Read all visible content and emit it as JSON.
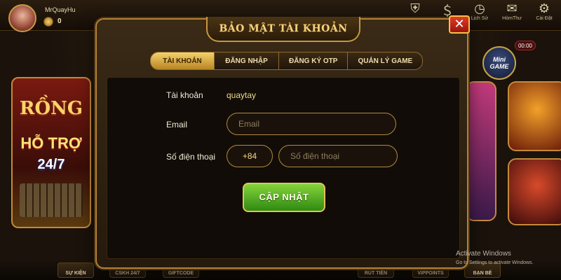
{
  "user": {
    "name": "MrQuayHu",
    "coins": "0"
  },
  "topbar": {
    "items": [
      {
        "icon": "shield-icon",
        "label": ""
      },
      {
        "icon": "dollar-icon",
        "label": ""
      },
      {
        "icon": "clock-icon",
        "label": "Lịch Sử"
      },
      {
        "icon": "mail-icon",
        "label": "HòmThư"
      },
      {
        "icon": "gear-icon",
        "label": "Cài Đặt"
      }
    ]
  },
  "left_banner": {
    "brand": "RỒNG",
    "line1": "HỖ TRỢ",
    "line2": "24/7"
  },
  "mini_game": {
    "label": "Mini GAME",
    "timer": "00:00"
  },
  "modal": {
    "title": "BẢO MẬT TÀI KHOẢN",
    "close": "✕",
    "tabs": [
      "TÀI KHOẢN",
      "ĐĂNG NHẬP",
      "ĐĂNG KÝ OTP",
      "QUẢN LÝ GAME"
    ],
    "active_tab": 0,
    "account_label": "Tài khoản",
    "account_value": "quaytay",
    "email_label": "Email",
    "email_placeholder": "Email",
    "phone_label": "Số điện thoại",
    "phone_prefix": "+84",
    "phone_placeholder": "Số điện thoại",
    "update_button": "CẬP NHẬT"
  },
  "bottombar": {
    "items": [
      "SỰ KIỆN",
      "CSKH 24/7",
      "GIFTCODE",
      "RÚT TIỀN",
      "VIPPOINTS",
      "BẠN BÈ"
    ]
  },
  "watermark": {
    "title": "Activate Windows",
    "subtitle": "Go to Settings to activate Windows."
  }
}
